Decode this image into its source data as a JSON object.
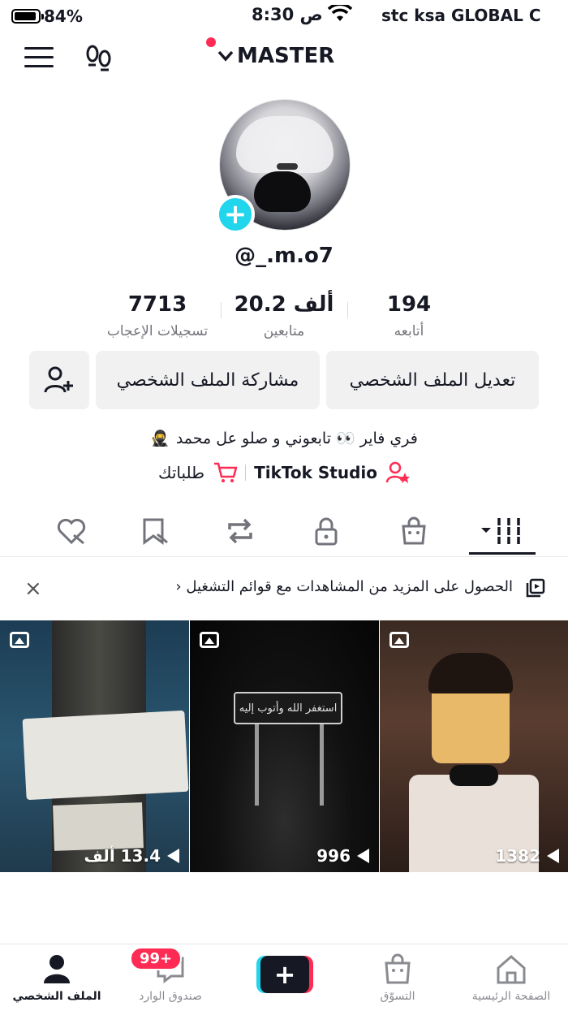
{
  "status_bar": {
    "battery": "84%",
    "time": "8:30 ص",
    "carrier": "stc ksa GLOBAL C"
  },
  "header": {
    "account_name": "MASTER"
  },
  "profile": {
    "username": "@_.m.o7"
  },
  "stats": [
    {
      "value": "194",
      "label": "أتابعه"
    },
    {
      "value": "20.2 ألف",
      "label": "متابعين"
    },
    {
      "value": "7713",
      "label": "تسجيلات الإعجاب"
    }
  ],
  "buttons": {
    "edit_profile": "تعديل الملف الشخصي",
    "share_profile": "مشاركة الملف الشخصي"
  },
  "bio": {
    "text": "فري فاير 👀 تابعوني و صلو عل محمد",
    "emoji": "🥷"
  },
  "links": {
    "studio": "TikTok Studio",
    "orders": "طلباتك"
  },
  "promo": {
    "text": "الحصول على المزيد من المشاهدات مع قوائم التشغيل",
    "close": "×"
  },
  "videos": [
    {
      "views": "13.4 ألف"
    },
    {
      "views": "996",
      "sign_text": "استغفر الله وأتوب إليه"
    },
    {
      "views": "1382"
    }
  ],
  "bottom_nav": {
    "home": "الصفحة الرئيسية",
    "shop": "التسوّق",
    "create": "+",
    "inbox": "صندوق الوارد",
    "inbox_badge": "99+",
    "profile": "الملف الشخصي"
  },
  "colors": {
    "accent_red": "#fe2c55",
    "accent_cyan": "#20d5ec",
    "text": "#161823"
  }
}
